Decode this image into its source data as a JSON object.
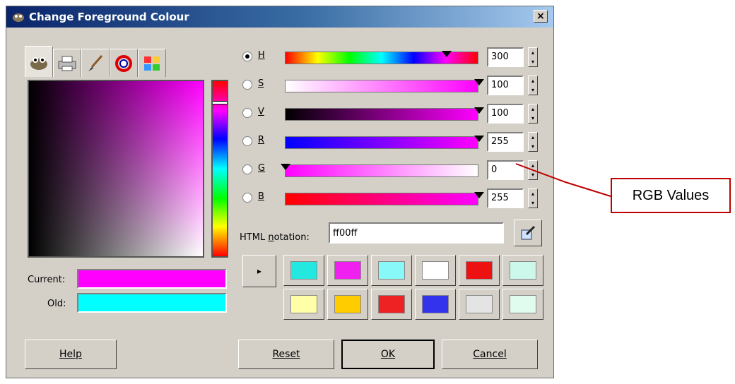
{
  "window": {
    "title": "Change Foreground Colour",
    "close_glyph": "×"
  },
  "tabs": [
    {
      "icon": "gimp-wilber-icon"
    },
    {
      "icon": "printer-icon"
    },
    {
      "icon": "paintbrush-icon"
    },
    {
      "icon": "color-wheel-icon"
    },
    {
      "icon": "palette-icon"
    }
  ],
  "channels": [
    {
      "key": "H",
      "value": "300",
      "selected": true
    },
    {
      "key": "S",
      "value": "100",
      "selected": false
    },
    {
      "key": "V",
      "value": "100",
      "selected": false
    },
    {
      "key": "R",
      "value": "255",
      "selected": false
    },
    {
      "key": "G",
      "value": "0",
      "selected": false
    },
    {
      "key": "B",
      "value": "255",
      "selected": false
    }
  ],
  "current": {
    "label": "Current:",
    "color": "#ff00ff"
  },
  "old": {
    "label": "Old:",
    "color": "#00ffff"
  },
  "html_notation": {
    "label": "HTML notation:",
    "value": "ff00ff"
  },
  "history": {
    "arrow": "▸",
    "colors": [
      "#22e8e0",
      "#f020f0",
      "#88f8f8",
      "#ffffff",
      "#ee1111",
      "#ccf8ec",
      "#ffffa8",
      "#ffcc00",
      "#ee2222",
      "#3333ee",
      "#e4e4e4",
      "#e0fcee"
    ]
  },
  "buttons": {
    "help": "Help",
    "reset": "Reset",
    "ok": "OK",
    "cancel": "Cancel"
  },
  "annotation": {
    "label": "RGB Values",
    "color": "#c00000"
  }
}
